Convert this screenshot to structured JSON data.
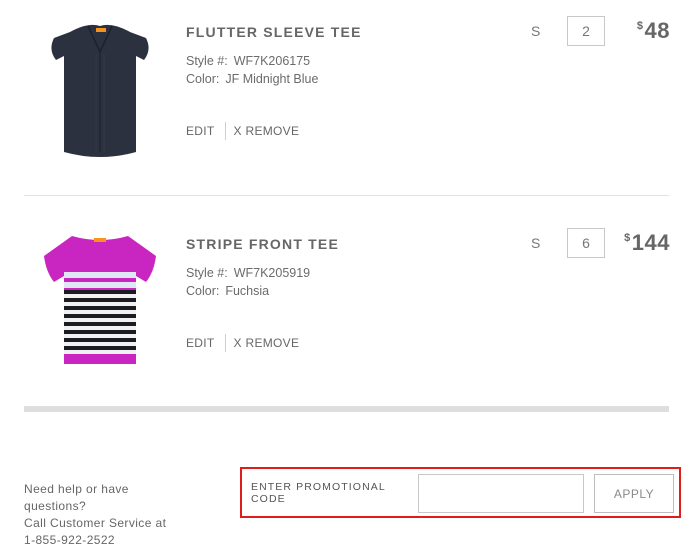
{
  "cart": {
    "items": [
      {
        "title": "FLUTTER SLEEVE TEE",
        "style_label": "Style #:",
        "style_value": "WF7K206175",
        "color_label": "Color:",
        "color_value": "JF Midnight Blue",
        "edit_label": "EDIT",
        "remove_label": "X REMOVE",
        "size": "S",
        "quantity": "2",
        "currency": "$",
        "price": "48",
        "garment_color": "#2c3140"
      },
      {
        "title": "STRIPE FRONT TEE",
        "style_label": "Style #:",
        "style_value": "WF7K205919",
        "color_label": "Color:",
        "color_value": "Fuchsia",
        "edit_label": "EDIT",
        "remove_label": "X REMOVE",
        "size": "S",
        "quantity": "6",
        "currency": "$",
        "price": "144",
        "garment_color": "#c925c0"
      }
    ]
  },
  "help": {
    "line1": "Need help or have",
    "line2": "questions?",
    "line3": "Call Customer Service at",
    "phone": "1-855-922-2522"
  },
  "promo": {
    "label": "ENTER PROMOTIONAL CODE",
    "value": "",
    "apply_label": "APPLY",
    "highlight_color": "#e01d1d"
  }
}
